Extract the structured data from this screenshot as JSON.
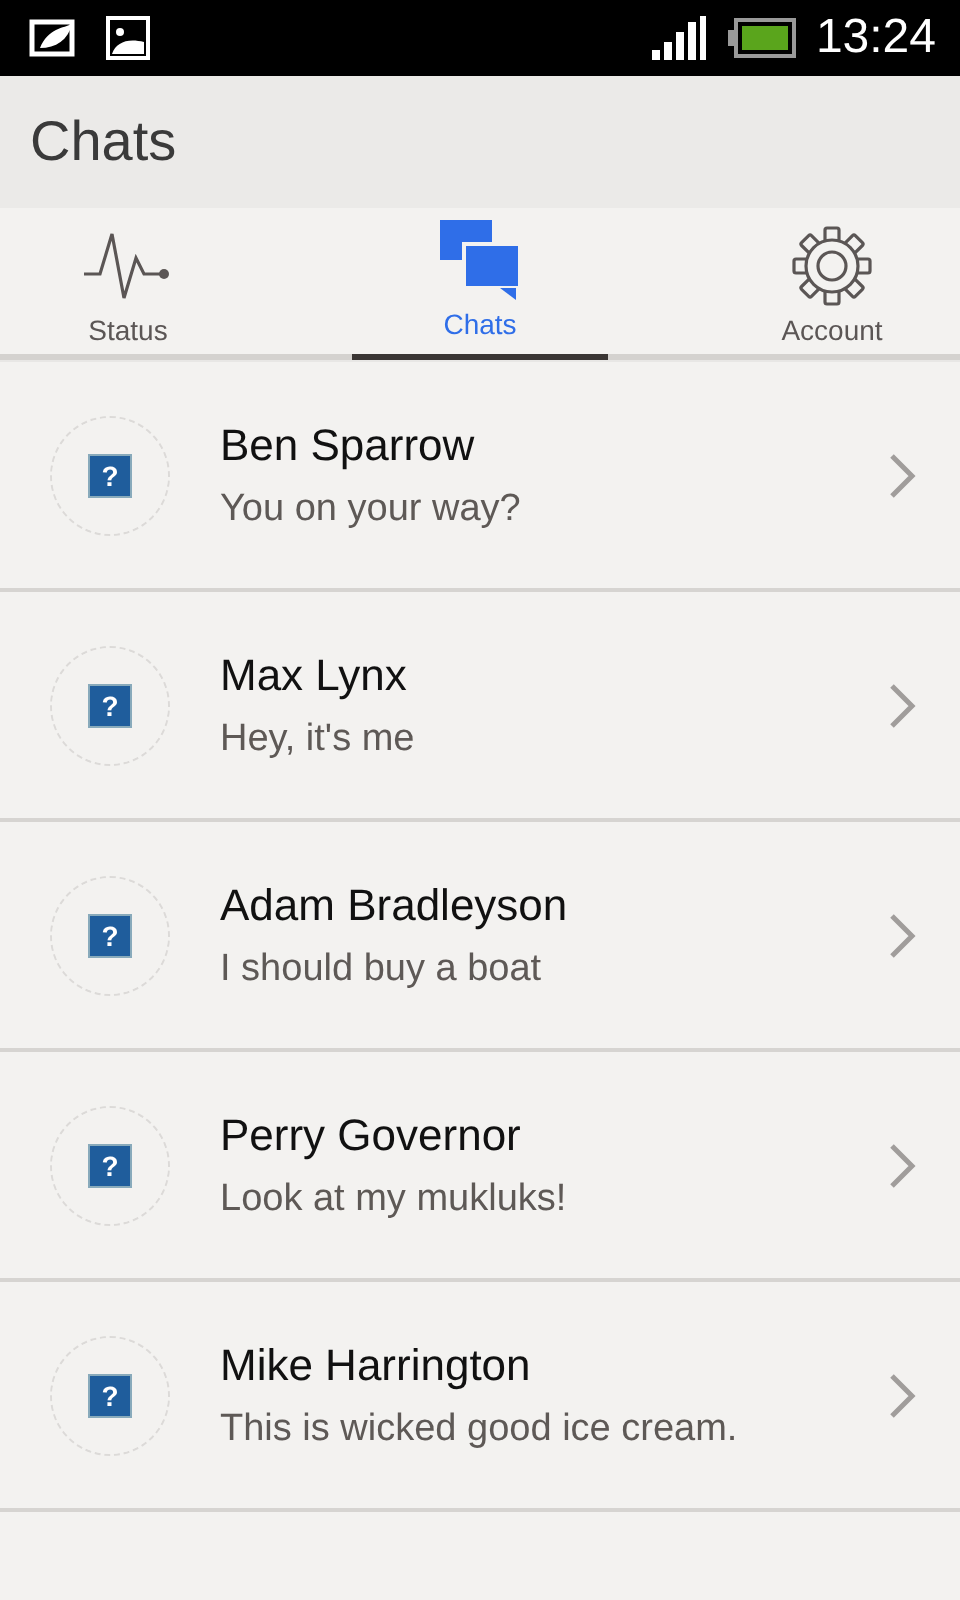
{
  "status_bar": {
    "time": "13:24"
  },
  "header": {
    "title": "Chats"
  },
  "tabs": [
    {
      "label": "Status",
      "kind": "pulse",
      "selected": false
    },
    {
      "label": "Chats",
      "kind": "chat",
      "selected": true
    },
    {
      "label": "Account",
      "kind": "gear",
      "selected": false
    }
  ],
  "chats": [
    {
      "name": "Ben Sparrow",
      "message": "You on your way?",
      "avatar": "?"
    },
    {
      "name": "Max Lynx",
      "message": "Hey, it's me",
      "avatar": "?"
    },
    {
      "name": "Adam Bradleyson",
      "message": "I should buy a boat",
      "avatar": "?"
    },
    {
      "name": "Perry Governor",
      "message": "Look at my mukluks!",
      "avatar": "?"
    },
    {
      "name": "Mike Harrington",
      "message": "This is wicked good ice cream.",
      "avatar": "?"
    }
  ]
}
